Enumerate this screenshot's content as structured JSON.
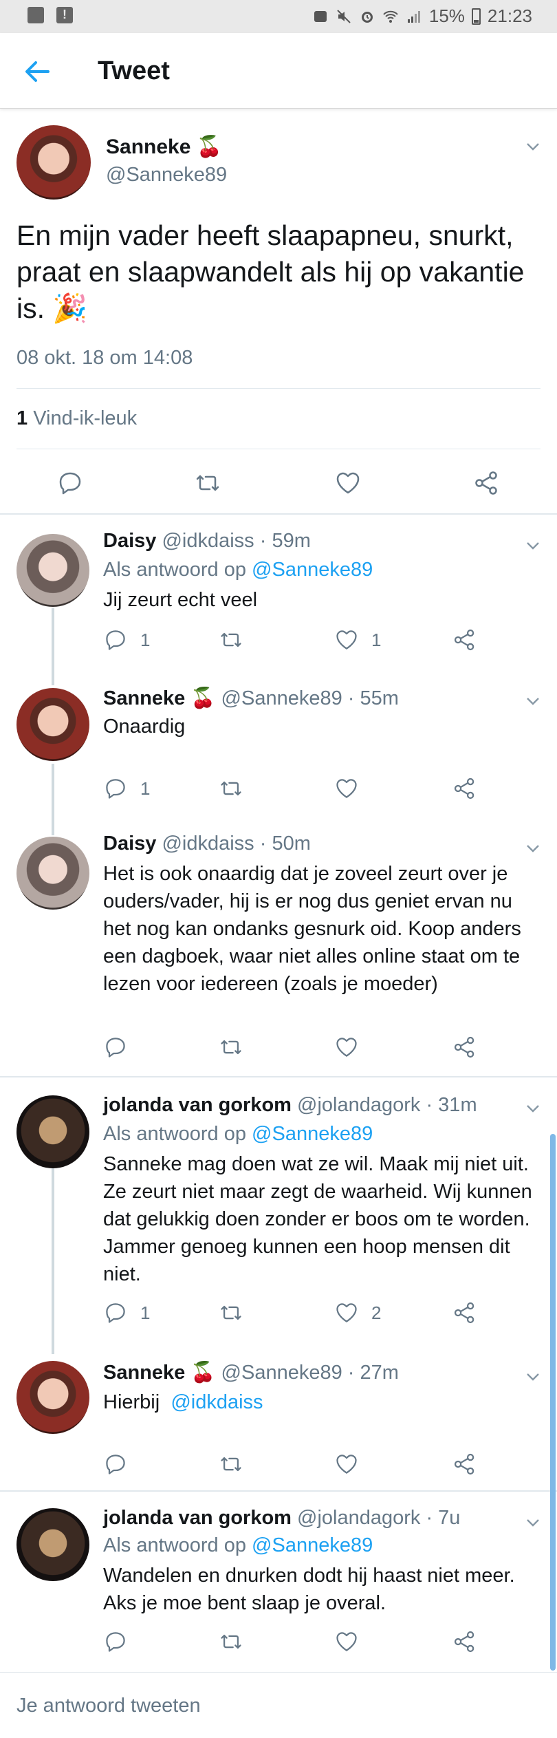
{
  "status_bar": {
    "battery": "15%",
    "time": "21:23"
  },
  "header": {
    "title": "Tweet"
  },
  "main_tweet": {
    "name": "Sanneke",
    "name_emoji": "🍒",
    "handle": "@Sanneke89",
    "text": "En mijn vader heeft slaapapneu, snurkt, praat en slaapwandelt als hij op vakantie is.",
    "text_emoji": "🎉",
    "date": "08 okt. 18 om 14:08",
    "likes_count": "1",
    "likes_label": "Vind-ik-leuk"
  },
  "replies": [
    {
      "name": "Daisy",
      "handle": "@idkdaiss",
      "time": "· 59m",
      "reply_prefix": "Als antwoord op",
      "reply_to": "@Sanneke89",
      "text": "Jij zeurt echt veel",
      "replies": "1",
      "likes": "1"
    },
    {
      "name": "Sanneke",
      "name_emoji": "🍒",
      "handle": "@Sanneke89",
      "time": "· 55m",
      "text": "Onaardig",
      "replies": "1",
      "likes": ""
    },
    {
      "name": "Daisy",
      "handle": "@idkdaiss",
      "time": "· 50m",
      "text": "Het is ook onaardig dat je zoveel zeurt over je ouders/vader, hij is er nog dus geniet ervan nu het nog kan ondanks gesnurk oid. Koop anders een dagboek, waar niet alles online staat om te lezen voor iedereen (zoals je moeder)",
      "replies": "",
      "likes": ""
    },
    {
      "name": "jolanda van gorkom",
      "handle": "@jolandagork",
      "time": "· 31m",
      "reply_prefix": "Als antwoord op",
      "reply_to": "@Sanneke89",
      "text": "Sanneke mag doen wat ze wil. Maak mij niet uit. Ze zeurt niet maar zegt de waarheid. Wij kunnen dat gelukkig doen zonder er boos om te worden. Jammer genoeg kunnen een hoop mensen dit niet.",
      "replies": "1",
      "likes": "2"
    },
    {
      "name": "Sanneke",
      "name_emoji": "🍒",
      "handle": "@Sanneke89",
      "time": "· 27m",
      "text": "Hierbij",
      "mention": "@idkdaiss",
      "replies": "",
      "likes": ""
    },
    {
      "name": "jolanda van gorkom",
      "handle": "@jolandagork",
      "time": "· 7u",
      "reply_prefix": "Als antwoord op",
      "reply_to": "@Sanneke89",
      "text": "Wandelen en dnurken dodt hij haast niet meer. Aks je moe bent slaap je overal.",
      "replies": "",
      "likes": ""
    }
  ],
  "compose": {
    "placeholder": "Je antwoord tweeten"
  },
  "colors": {
    "accent": "#1da1f2",
    "secondary_text": "#657786",
    "divider": "#e1e8ed"
  }
}
